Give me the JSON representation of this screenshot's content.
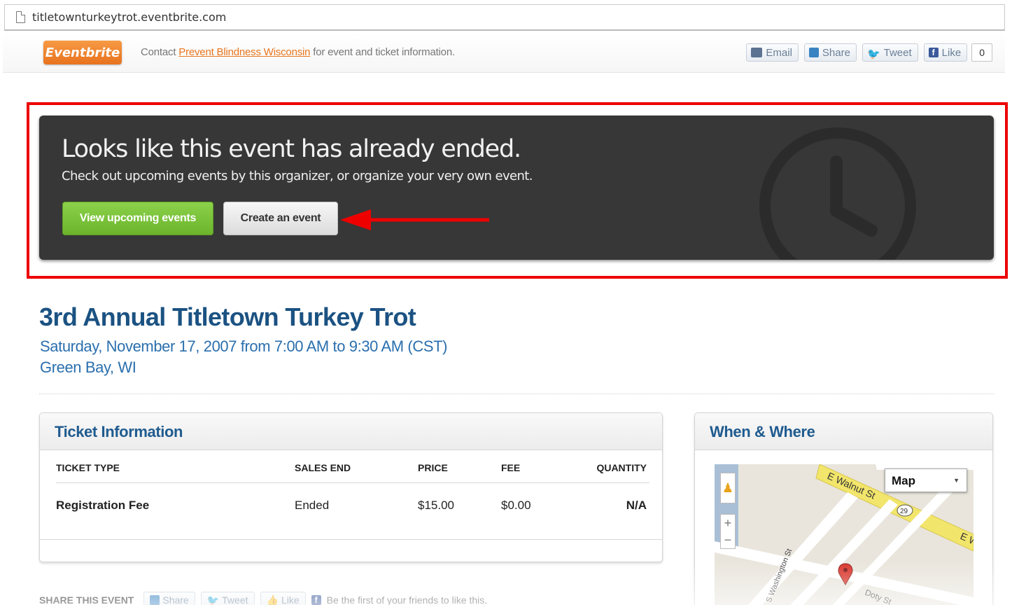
{
  "browser": {
    "url": "titletownturkeytrot.eventbrite.com"
  },
  "topbar": {
    "logo": "Eventbrite",
    "contact_prefix": "Contact ",
    "contact_link": "Prevent Blindness Wisconsin",
    "contact_suffix": " for event and ticket information.",
    "buttons": {
      "email": "Email",
      "share": "Share",
      "tweet": "Tweet",
      "like": "Like"
    },
    "like_count": "0"
  },
  "banner": {
    "title": "Looks like this event has already ended.",
    "subtitle": "Check out upcoming events by this organizer, or organize your very own event.",
    "view_upcoming": "View upcoming events",
    "create_event": "Create an event",
    "highlight_color": "#ee0000"
  },
  "event": {
    "title": "3rd Annual Titletown Turkey Trot",
    "date": "Saturday, November 17, 2007 from 7:00 AM to 9:30 AM (CST)",
    "location": "Green Bay, WI"
  },
  "tickets": {
    "heading": "Ticket Information",
    "columns": [
      "TICKET TYPE",
      "SALES END",
      "PRICE",
      "FEE",
      "QUANTITY"
    ],
    "rows": [
      {
        "type": "Registration Fee",
        "sales_end": "Ended",
        "price": "$15.00",
        "fee": "$0.00",
        "quantity": "N/A"
      }
    ]
  },
  "where": {
    "heading": "When & Where",
    "map_type": "Map",
    "streets": [
      "E Walnut St",
      "S Washington St",
      "Doty St",
      "29",
      "E W"
    ]
  },
  "share": {
    "label": "SHARE THIS EVENT",
    "share": "Share",
    "tweet": "Tweet",
    "like": "Like",
    "friends_text": "Be the first of your friends to like this."
  }
}
